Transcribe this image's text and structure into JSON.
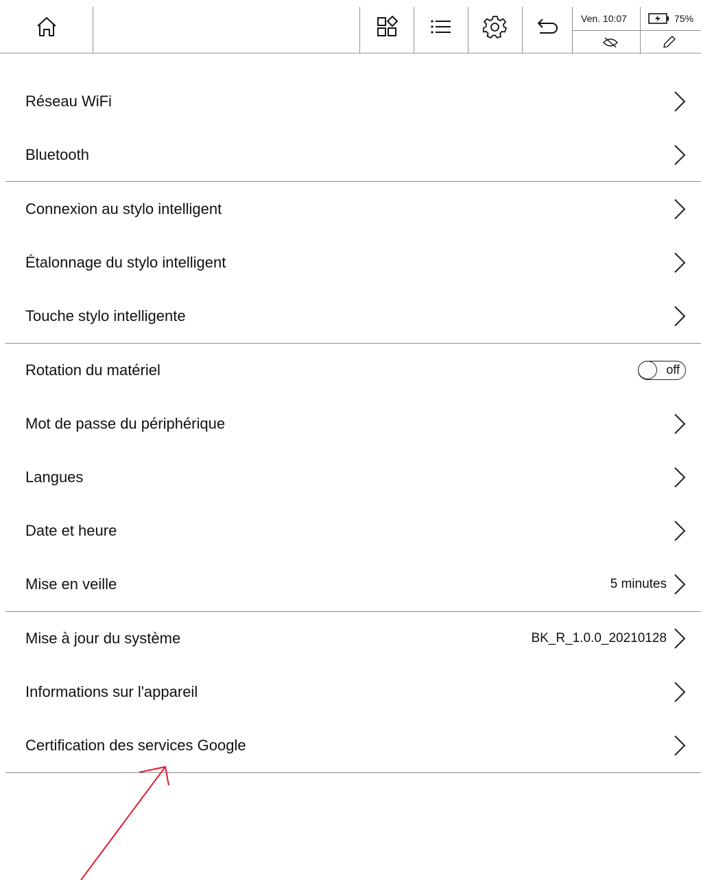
{
  "toolbar": {
    "home_icon": "home-icon",
    "apps_icon": "apps-grid-icon",
    "list_icon": "list-icon",
    "settings_icon": "gear-icon",
    "back_icon": "back-arrow-icon"
  },
  "status": {
    "time": "Ven. 10:07",
    "battery": "75%",
    "battery_icon": "battery-charging-icon",
    "eye_icon": "eye-off-icon",
    "pen_icon": "pen-icon"
  },
  "settings": {
    "wifi": "Réseau WiFi",
    "bluetooth": "Bluetooth",
    "pen_connection": "Connexion au stylo intelligent",
    "pen_calibration": "Étalonnage du stylo intelligent",
    "pen_button": "Touche stylo intelligente",
    "rotation": "Rotation du matériel",
    "rotation_state": "off",
    "password": "Mot de passe du périphérique",
    "languages": "Langues",
    "datetime": "Date et heure",
    "sleep": "Mise en veille",
    "sleep_value": "5 minutes",
    "system_update": "Mise à jour du système",
    "system_update_value": "BK_R_1.0.0_20210128",
    "device_info": "Informations sur l'appareil",
    "google_cert": "Certification des services Google"
  },
  "annotation": {
    "arrow_color": "#e8192c"
  }
}
